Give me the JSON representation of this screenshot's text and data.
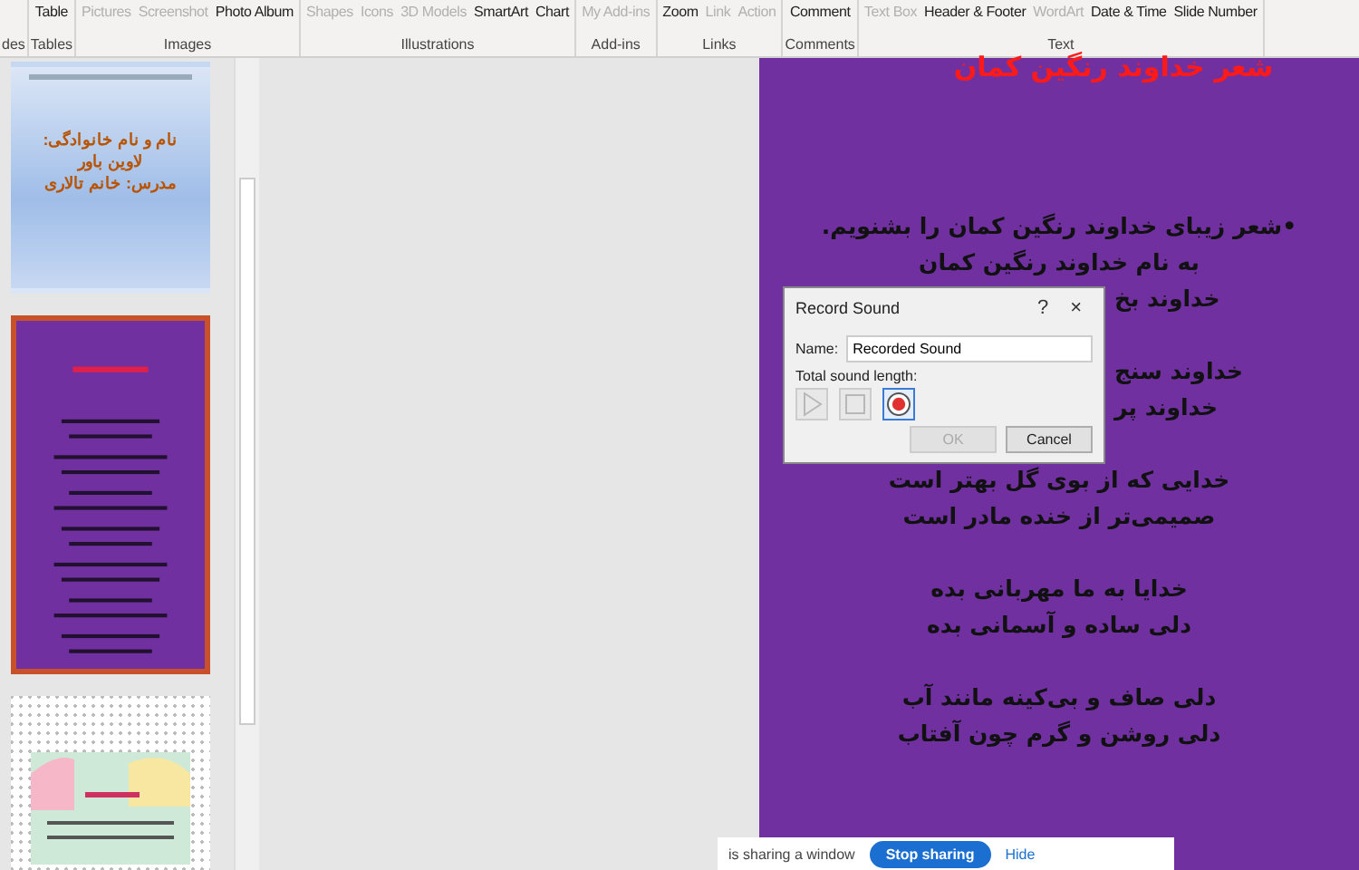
{
  "ribbon": {
    "groups": [
      {
        "label": "des"
      },
      {
        "label": "Tables",
        "buttons": [
          {
            "label": "Table",
            "disabled": false
          }
        ]
      },
      {
        "label": "Images",
        "buttons": [
          {
            "label": "Pictures",
            "disabled": true
          },
          {
            "label": "Screenshot",
            "disabled": true
          },
          {
            "label": "Photo Album",
            "disabled": false
          }
        ]
      },
      {
        "label": "Illustrations",
        "buttons": [
          {
            "label": "Shapes",
            "disabled": true
          },
          {
            "label": "Icons",
            "disabled": true
          },
          {
            "label": "3D Models",
            "disabled": true
          },
          {
            "label": "SmartArt",
            "disabled": false
          },
          {
            "label": "Chart",
            "disabled": false
          }
        ]
      },
      {
        "label": "Add-ins",
        "buttons": [
          {
            "label": "My Add-ins",
            "disabled": true
          }
        ]
      },
      {
        "label": "Links",
        "buttons": [
          {
            "label": "Zoom",
            "disabled": false
          },
          {
            "label": "Link",
            "disabled": true
          },
          {
            "label": "Action",
            "disabled": true
          }
        ]
      },
      {
        "label": "Comments",
        "buttons": [
          {
            "label": "Comment",
            "disabled": false
          }
        ]
      },
      {
        "label": "Text",
        "buttons": [
          {
            "label": "Text Box",
            "disabled": true
          },
          {
            "label": "Header & Footer",
            "disabled": false
          },
          {
            "label": "WordArt",
            "disabled": true
          },
          {
            "label": "Date & Time",
            "disabled": false
          },
          {
            "label": "Slide Number",
            "disabled": false
          }
        ]
      }
    ]
  },
  "thumbnails": [
    {
      "kind": "title",
      "selected": false,
      "lines": [
        "نام و نام خانوادگی:",
        "لاوین باور",
        "مدرس: خانم تالاری"
      ]
    },
    {
      "kind": "poem",
      "selected": true
    },
    {
      "kind": "picture",
      "selected": false
    }
  ],
  "slide": {
    "title": "شعر خداوند رنگین کمان",
    "stanzas": [
      [
        {
          "text": "•شعر زیبای خداوند رنگین کمان را بشنویم.",
          "partial": false
        },
        {
          "text": "به نام خداوند رنگین کمان",
          "partial": false
        },
        {
          "text": "خداوند بخ",
          "partial": true
        }
      ],
      [
        {
          "text": "خداوند سنج",
          "partial": true
        },
        {
          "text": "خداوند پر",
          "partial": true
        }
      ],
      [
        {
          "text": "خدایی که از بوی گل بهتر است",
          "partial": false
        },
        {
          "text": "صمیمی‌تر از خنده مادر است",
          "partial": false
        }
      ],
      [
        {
          "text": "خدایا به ما مهربانی بده",
          "partial": false
        },
        {
          "text": "دلی ساده و آسمانی بده",
          "partial": false
        }
      ],
      [
        {
          "text": "دلی صاف و بی‌کینه مانند آب",
          "partial": false
        },
        {
          "text": "دلی روشن و گرم چون آفتاب",
          "partial": false
        }
      ]
    ]
  },
  "dialog": {
    "title": "Record Sound",
    "help": "?",
    "close": "×",
    "name_label": "Name:",
    "name_value": "Recorded Sound",
    "length_label": "Total sound length:",
    "controls": [
      {
        "kind": "play",
        "disabled": true,
        "selected": false
      },
      {
        "kind": "stop",
        "disabled": true,
        "selected": false
      },
      {
        "kind": "record",
        "disabled": false,
        "selected": true
      }
    ],
    "buttons": [
      {
        "label": "OK",
        "disabled": true
      },
      {
        "label": "Cancel",
        "disabled": false
      }
    ]
  },
  "share_bar": {
    "message": "is sharing a window",
    "stop": "Stop sharing",
    "hide": "Hide"
  }
}
